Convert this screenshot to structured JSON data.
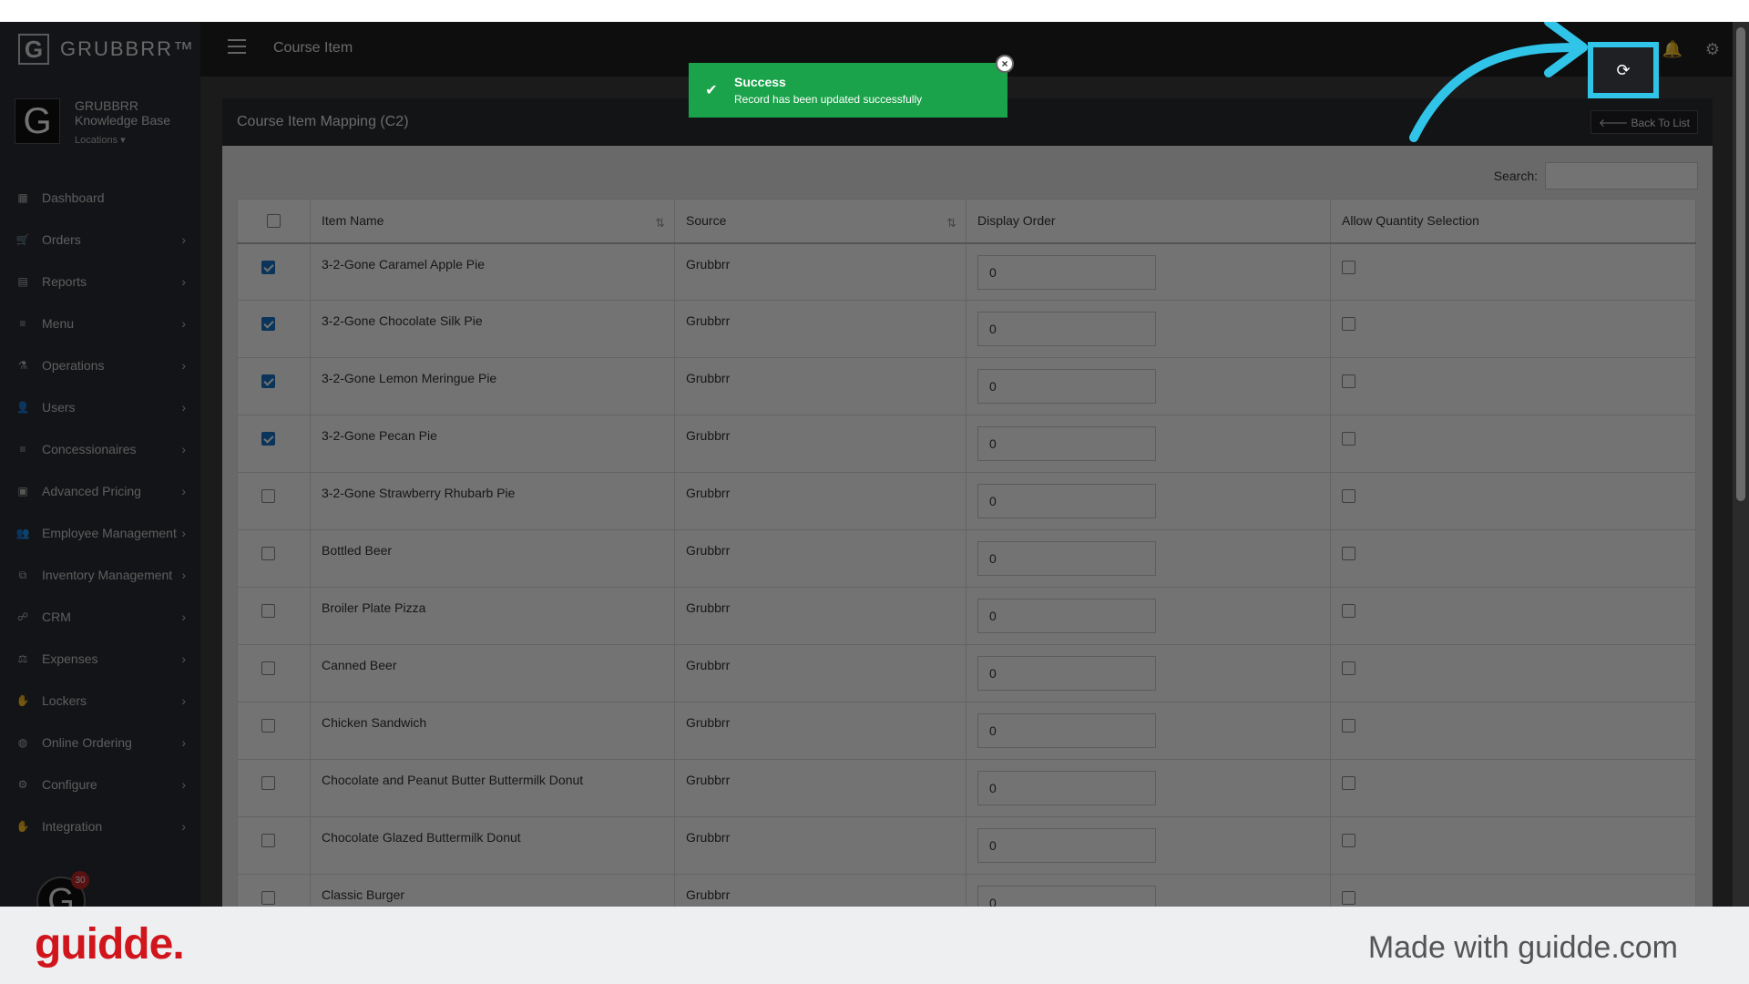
{
  "app": {
    "brand": "GRUBBRR™",
    "brand_letter": "G",
    "page_heading": "Course Item"
  },
  "profile": {
    "letter": "G",
    "line1": "GRUBBRR",
    "line2": "Knowledge Base",
    "locations": "Locations ▾"
  },
  "sidebar": {
    "items": [
      {
        "label": "Dashboard",
        "icon": "▦"
      },
      {
        "label": "Orders",
        "icon": "🛒"
      },
      {
        "label": "Reports",
        "icon": "▤"
      },
      {
        "label": "Menu",
        "icon": "≡"
      },
      {
        "label": "Operations",
        "icon": "⚗"
      },
      {
        "label": "Users",
        "icon": "👤"
      },
      {
        "label": "Concessionaires",
        "icon": "≡"
      },
      {
        "label": "Advanced Pricing",
        "icon": "▣"
      },
      {
        "label": "Employee Management",
        "icon": "👥"
      },
      {
        "label": "Inventory Management",
        "icon": "⧉"
      },
      {
        "label": "CRM",
        "icon": "☍"
      },
      {
        "label": "Expenses",
        "icon": "⚖"
      },
      {
        "label": "Lockers",
        "icon": "✋"
      },
      {
        "label": "Online Ordering",
        "icon": "◍"
      },
      {
        "label": "Configure",
        "icon": "⚙"
      },
      {
        "label": "Integration",
        "icon": "✋"
      }
    ],
    "avatar_letter": "G",
    "badge_count": "30"
  },
  "toast": {
    "title": "Success",
    "message": "Record has been updated successfully",
    "close": "×"
  },
  "panel": {
    "title": "Course Item Mapping (C2)",
    "back_label": "🡐 Back To List",
    "search_label": "Search:",
    "columns": [
      "Item Name",
      "Source",
      "Display Order",
      "Allow Quantity Selection"
    ],
    "rows": [
      {
        "name": "3-2-Gone Caramel Apple Pie",
        "source": "Grubbrr",
        "order": "0",
        "selected": true
      },
      {
        "name": "3-2-Gone Chocolate Silk Pie",
        "source": "Grubbrr",
        "order": "0",
        "selected": true
      },
      {
        "name": "3-2-Gone Lemon Meringue Pie",
        "source": "Grubbrr",
        "order": "0",
        "selected": true
      },
      {
        "name": "3-2-Gone Pecan Pie",
        "source": "Grubbrr",
        "order": "0",
        "selected": true
      },
      {
        "name": "3-2-Gone Strawberry Rhubarb Pie",
        "source": "Grubbrr",
        "order": "0",
        "selected": false
      },
      {
        "name": "Bottled Beer",
        "source": "Grubbrr",
        "order": "0",
        "selected": false
      },
      {
        "name": "Broiler Plate Pizza",
        "source": "Grubbrr",
        "order": "0",
        "selected": false
      },
      {
        "name": "Canned Beer",
        "source": "Grubbrr",
        "order": "0",
        "selected": false
      },
      {
        "name": "Chicken Sandwich",
        "source": "Grubbrr",
        "order": "0",
        "selected": false
      },
      {
        "name": "Chocolate and Peanut Butter Buttermilk Donut",
        "source": "Grubbrr",
        "order": "0",
        "selected": false
      },
      {
        "name": "Chocolate Glazed Buttermilk Donut",
        "source": "Grubbrr",
        "order": "0",
        "selected": false
      },
      {
        "name": "Classic Burger",
        "source": "Grubbrr",
        "order": "0",
        "selected": false
      }
    ]
  },
  "footer": {
    "logo": "guidde.",
    "credit": "Made with guidde.com"
  },
  "colors": {
    "highlight": "#30c4e8",
    "toast": "#1aa34a",
    "brand_red": "#d0151c"
  }
}
